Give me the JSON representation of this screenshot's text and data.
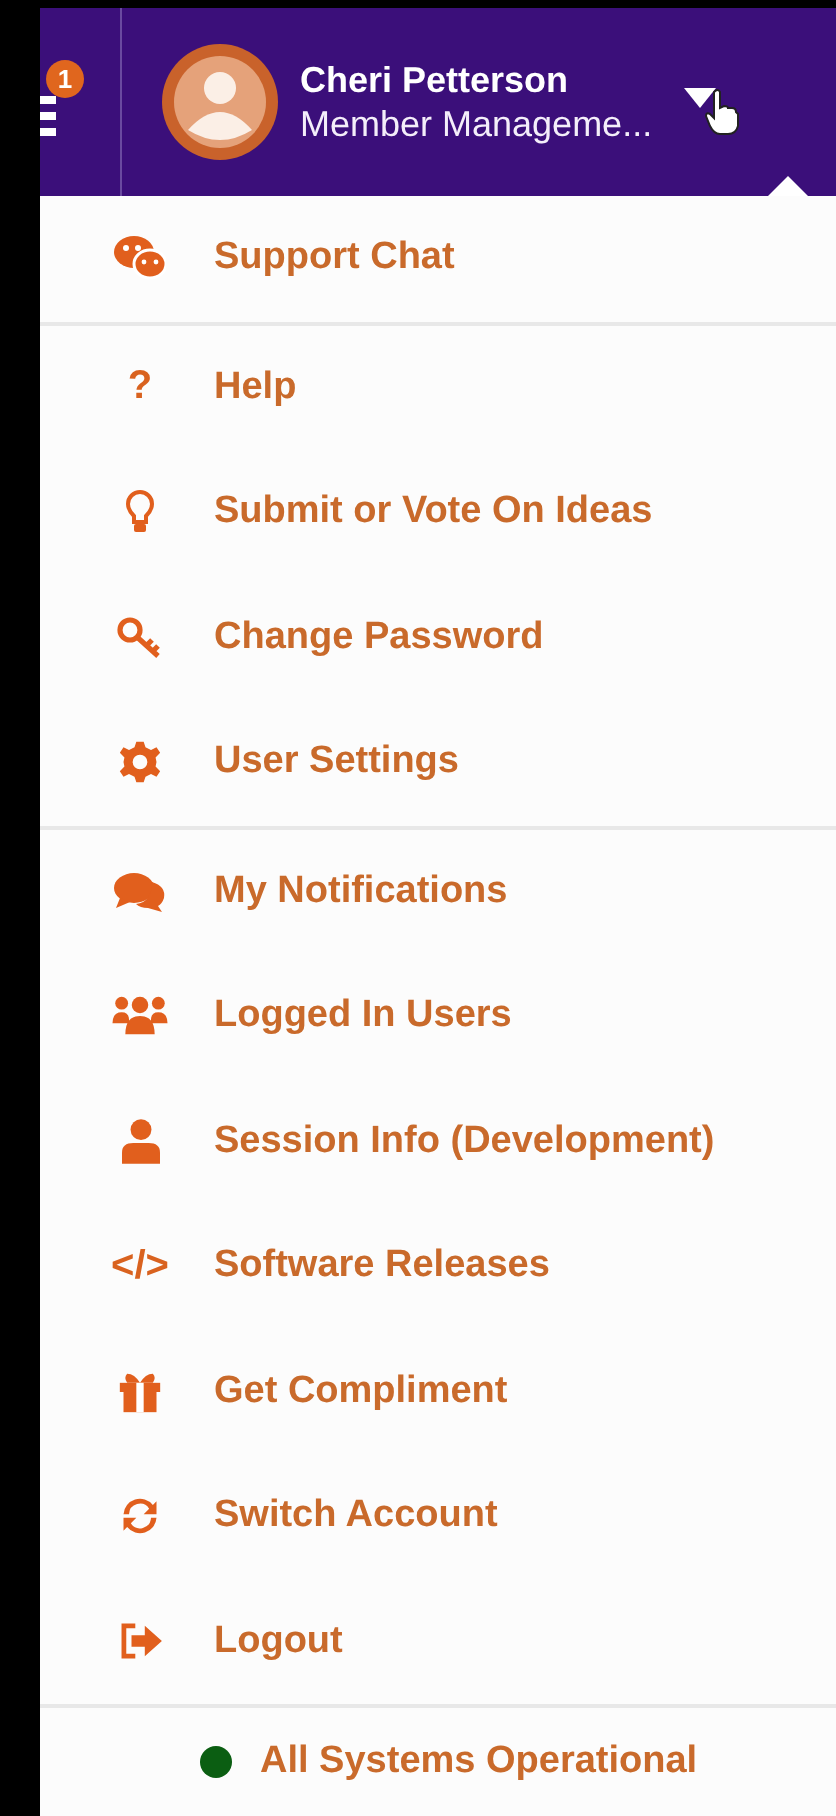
{
  "header": {
    "notification_count": "1",
    "user_name": "Cheri Petterson",
    "user_role": "Member Manageme..."
  },
  "menu_sections": [
    [
      {
        "label": "Support Chat",
        "kind": "chat"
      }
    ],
    [
      {
        "label": "Help",
        "kind": "glyph",
        "glyph": "?"
      },
      {
        "label": "Submit or Vote On Ideas",
        "kind": "bulb"
      },
      {
        "label": "Change Password",
        "kind": "key"
      },
      {
        "label": "User Settings",
        "kind": "gear"
      }
    ],
    [
      {
        "label": "My Notifications",
        "kind": "comments"
      },
      {
        "label": "Logged In Users",
        "kind": "users"
      },
      {
        "label": "Session Info (Development)",
        "kind": "user"
      },
      {
        "label": "Software Releases",
        "kind": "glyph",
        "glyph": "</>"
      },
      {
        "label": "Get Compliment",
        "kind": "gift"
      },
      {
        "label": "Switch Account",
        "kind": "refresh"
      },
      {
        "label": "Logout",
        "kind": "logout"
      }
    ]
  ],
  "status": {
    "label": "All Systems Operational",
    "color": "#0b5e12"
  }
}
